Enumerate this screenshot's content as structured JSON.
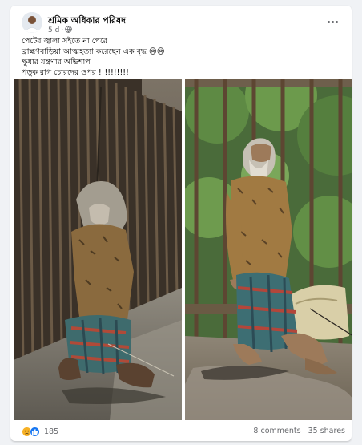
{
  "post": {
    "author": "শ্রমিক অধিকার পরিষদ",
    "time": "5 d",
    "text_lines": [
      "পেটের জ্বালা সইতে না পেরে",
      "ব্রাহ্মণবাড়িয়া আত্মহত্যা করেছেন এক বৃদ্ধ 😢😢",
      "ক্ষুধার যন্ত্রণার অভিশাপ",
      "পড়ুক রাগ চোরদের ওপর !!!!!!!!!!"
    ]
  },
  "icons": {
    "avatar": "avatar-icon",
    "privacy": "globe-icon",
    "menu": "more-options-icon",
    "reaction_1": "sad-reaction-icon",
    "reaction_2": "like-reaction-icon"
  },
  "footer": {
    "reaction_count": "185",
    "comments": "8 comments",
    "shares": "35 shares"
  },
  "colors": {
    "page_bg": "#f0f2f5",
    "card_bg": "#ffffff",
    "like_blue": "#1877f2",
    "sad_yellow": "#f7b125",
    "secondary_text": "#65676b"
  }
}
